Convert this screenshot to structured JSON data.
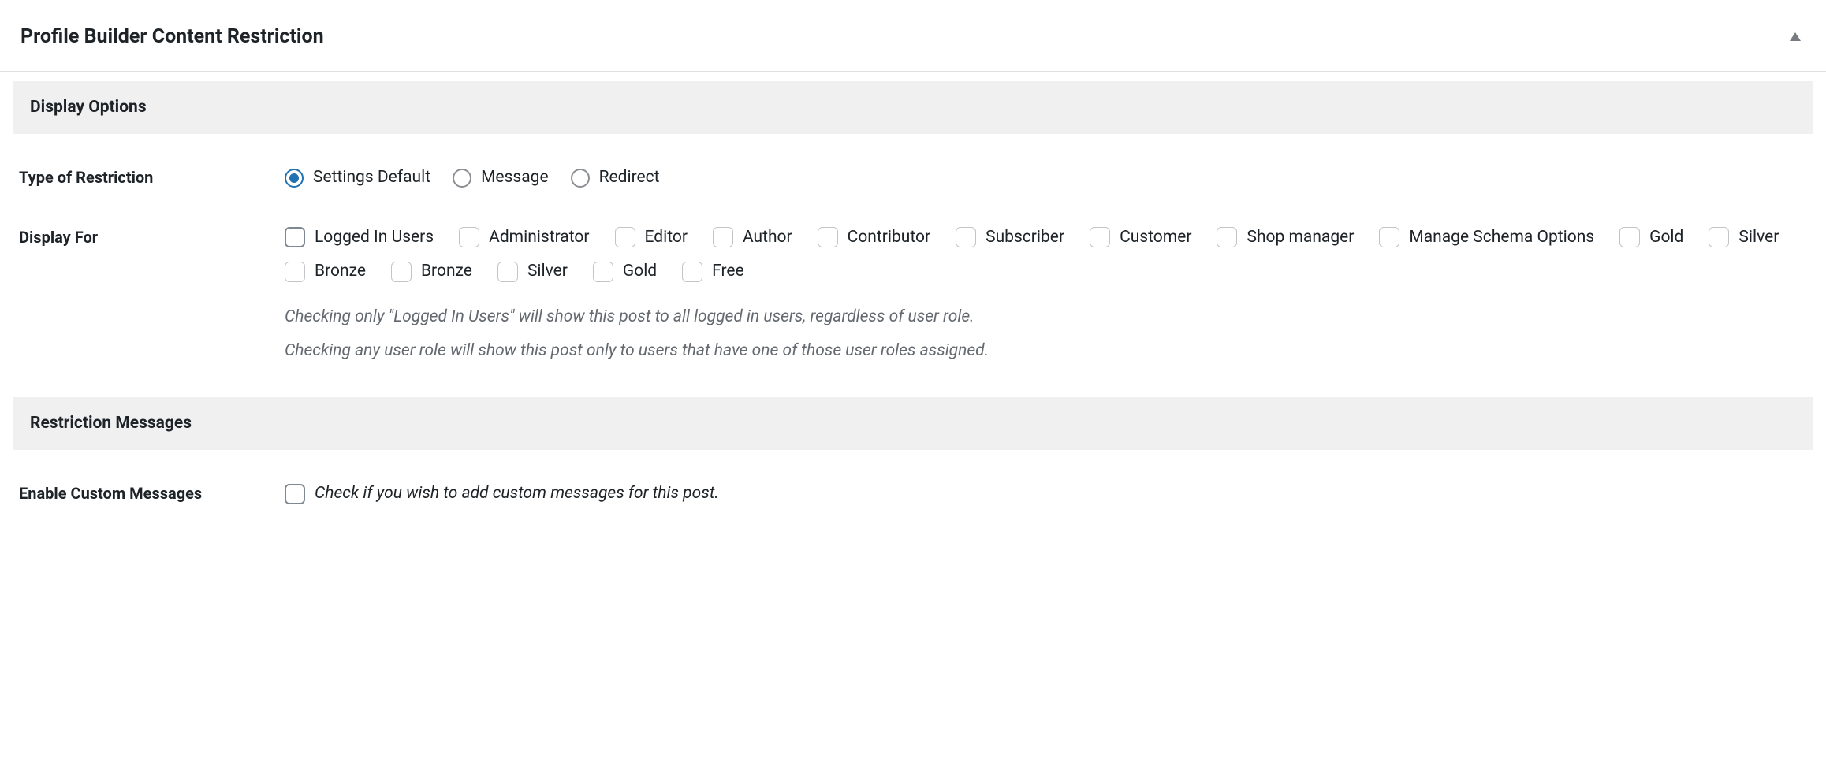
{
  "panel": {
    "title": "Profile Builder Content Restriction"
  },
  "sections": {
    "display_options": "Display Options",
    "restriction_messages": "Restriction Messages"
  },
  "typeOfRestriction": {
    "label": "Type of Restriction",
    "options": [
      {
        "label": "Settings Default",
        "checked": true
      },
      {
        "label": "Message",
        "checked": false
      },
      {
        "label": "Redirect",
        "checked": false
      }
    ]
  },
  "displayFor": {
    "label": "Display For",
    "roles": [
      {
        "label": "Logged In Users",
        "primary": true
      },
      {
        "label": "Administrator"
      },
      {
        "label": "Editor"
      },
      {
        "label": "Author"
      },
      {
        "label": "Contributor"
      },
      {
        "label": "Subscriber"
      },
      {
        "label": "Customer"
      },
      {
        "label": "Shop manager"
      },
      {
        "label": "Manage Schema Options"
      },
      {
        "label": "Gold"
      },
      {
        "label": "Silver"
      },
      {
        "label": "Bronze"
      },
      {
        "label": "Bronze"
      },
      {
        "label": "Silver"
      },
      {
        "label": "Gold"
      },
      {
        "label": "Free"
      }
    ],
    "help1": "Checking only \"Logged In Users\" will show this post to all logged in users, regardless of user role.",
    "help2": "Checking any user role will show this post only to users that have one of those user roles assigned."
  },
  "enableCustomMessages": {
    "label": "Enable Custom Messages",
    "checkboxHelp": "Check if you wish to add custom messages for this post."
  }
}
